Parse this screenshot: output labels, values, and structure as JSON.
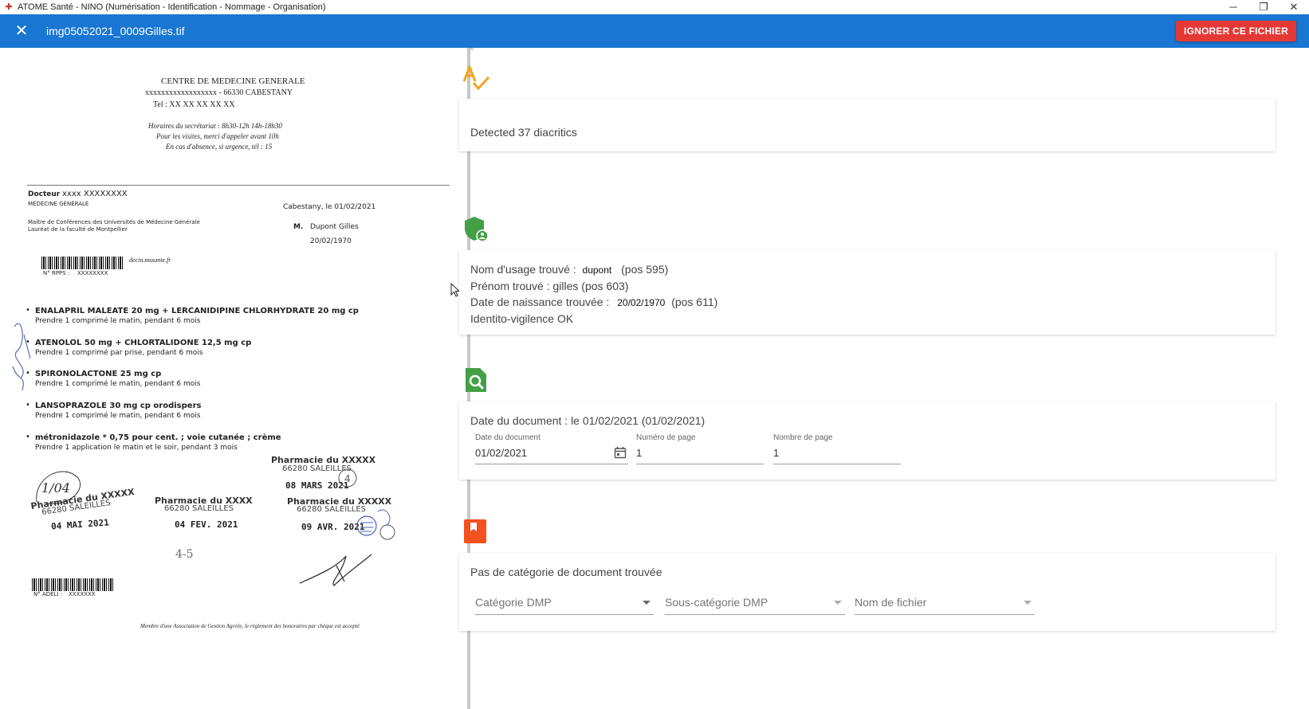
{
  "window": {
    "title": "ATOME Santé - NINO (Numérisation - Identification - Nommage - Organisation)",
    "minimize": "─",
    "maximize": "❐",
    "close": "✕"
  },
  "appbar": {
    "close_icon": "✕",
    "filename": "img05052021_0009Gilles.tif",
    "ignore_label": "IGNORER CE FICHIER"
  },
  "document": {
    "center_name": "CENTRE DE MEDECINE GENERALE",
    "address_line": "xxxxxxxxxxxxxxxxxx - 66330 CABESTANY",
    "tel": "Tel : XX XX XX XX XX",
    "hours_1": "Horaires du secrétariat : 8h30-12h   14h-18h30",
    "hours_2": "Pour les visites, merci d'appeler avant 10h",
    "hours_3": "En cas d'absence, si urgence, tél : 15",
    "doctor_label": "Docteur",
    "doctor_name": "xxxx XXXXXXXX",
    "doctor_specialty": "MÉDECINE GÉNÉRALE",
    "doctor_title_1": "Maître de Conférences des Universités de Médecine Générale",
    "doctor_title_2": "Lauréat de la faculté de Montpellier",
    "place_date": "Cabestany, le 01/02/2021",
    "patient_civility": "M.",
    "patient_name": "Dupont Gilles",
    "patient_dob": "20/02/1970",
    "email_fragment": "decin.mssante.fr",
    "rpps_label": "N° RPPS :",
    "rpps_value": "XXXXXXXX",
    "prescriptions": [
      {
        "drug": "ENALAPRIL MALEATE 20 mg + LERCANIDIPINE CHLORHYDRATE 20 mg cp",
        "posology": "Prendre 1 comprimé le matin, pendant 6 mois"
      },
      {
        "drug": "ATENOLOL 50 mg + CHLORTALIDONE 12,5 mg cp",
        "posology": "Prendre 1 comprimé par prise, pendant 6 mois"
      },
      {
        "drug": "SPIRONOLACTONE 25 mg cp",
        "posology": "Prendre 1 comprimé le matin, pendant 6 mois"
      },
      {
        "drug": "LANSOPRAZOLE 30 mg cp orodispers",
        "posology": "Prendre 1 comprimé le matin, pendant 6 mois"
      },
      {
        "drug": "métronidazole * 0,75 pour cent. ; voie cutanée ; crème",
        "posology": "Prendre 1 application le matin et le soir, pendant 3 mois"
      }
    ],
    "stamps": [
      {
        "name": "Pharmacie du XXXXX",
        "city": "66280 SALEILLES",
        "date": "08 MARS 2021"
      },
      {
        "name": "Pharmacie du XXXXX",
        "city": "66280 SALEILLES",
        "date": "04 MAI 2021"
      },
      {
        "name": "Pharmacie du XXXX",
        "city": "66280 SALEILLES",
        "date": "04 FEV. 2021"
      },
      {
        "name": "Pharmacie du XXXXX",
        "city": "66280 SALEILLES",
        "date": "09 AVR. 2021"
      }
    ],
    "handwritten_note": "4-5",
    "adeli_label": "N° ADELI :",
    "adeli_value": "XXXXXXX",
    "footer": "Membre d'une Association de Gestion Agréée, le règlement des honoraires par chèque est accepté"
  },
  "diacritics": {
    "icon": "spellcheck-icon",
    "message": "Detected 37 diacritics"
  },
  "identity": {
    "icon": "shield-account-icon",
    "nom_label": "Nom d'usage trouvé :",
    "nom_value": "dupont",
    "nom_pos": "(pos 595)",
    "prenom_line": "Prénom trouvé : gilles (pos 603)",
    "dob_label": "Date de naissance trouvée :",
    "dob_value": "20/02/1970",
    "dob_pos": "(pos 611)",
    "status": "Identito-vigilence OK"
  },
  "date_section": {
    "icon": "file-search-icon",
    "message": "Date du document : le 01/02/2021 (01/02/2021)",
    "date_label": "Date du document",
    "date_value": "01/02/2021",
    "page_label": "Numéro de page",
    "page_value": "1",
    "pages_label": "Nombre de page",
    "pages_value": "1"
  },
  "category": {
    "icon": "bookmark-icon",
    "message": "Pas de catégorie de document trouvée",
    "cat_placeholder": "Catégorie DMP",
    "subcat_placeholder": "Sous-catégorie DMP",
    "filename_placeholder": "Nom de fichier"
  },
  "colors": {
    "appbar": "#1976d2",
    "ignore_button": "#e53935",
    "spellcheck": "#f2a51a",
    "shield": "#43a047",
    "file_search": "#43a047",
    "bookmark": "#f4511e"
  }
}
